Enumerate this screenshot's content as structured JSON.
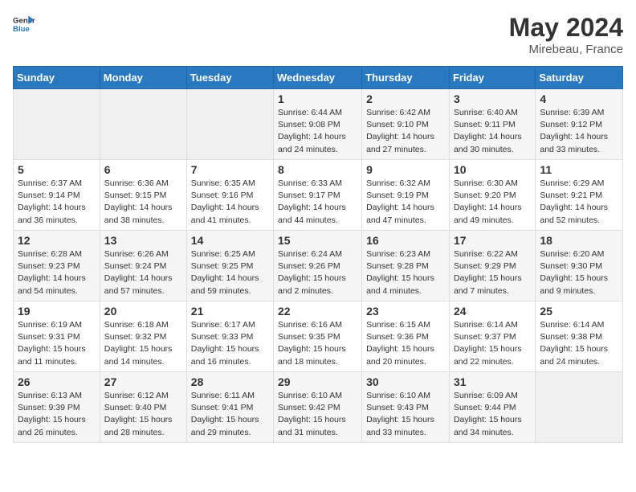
{
  "header": {
    "logo_line1": "General",
    "logo_line2": "Blue",
    "month": "May 2024",
    "location": "Mirebeau, France"
  },
  "weekdays": [
    "Sunday",
    "Monday",
    "Tuesday",
    "Wednesday",
    "Thursday",
    "Friday",
    "Saturday"
  ],
  "weeks": [
    [
      {
        "day": "",
        "info": ""
      },
      {
        "day": "",
        "info": ""
      },
      {
        "day": "",
        "info": ""
      },
      {
        "day": "1",
        "info": "Sunrise: 6:44 AM\nSunset: 9:08 PM\nDaylight: 14 hours\nand 24 minutes."
      },
      {
        "day": "2",
        "info": "Sunrise: 6:42 AM\nSunset: 9:10 PM\nDaylight: 14 hours\nand 27 minutes."
      },
      {
        "day": "3",
        "info": "Sunrise: 6:40 AM\nSunset: 9:11 PM\nDaylight: 14 hours\nand 30 minutes."
      },
      {
        "day": "4",
        "info": "Sunrise: 6:39 AM\nSunset: 9:12 PM\nDaylight: 14 hours\nand 33 minutes."
      }
    ],
    [
      {
        "day": "5",
        "info": "Sunrise: 6:37 AM\nSunset: 9:14 PM\nDaylight: 14 hours\nand 36 minutes."
      },
      {
        "day": "6",
        "info": "Sunrise: 6:36 AM\nSunset: 9:15 PM\nDaylight: 14 hours\nand 38 minutes."
      },
      {
        "day": "7",
        "info": "Sunrise: 6:35 AM\nSunset: 9:16 PM\nDaylight: 14 hours\nand 41 minutes."
      },
      {
        "day": "8",
        "info": "Sunrise: 6:33 AM\nSunset: 9:17 PM\nDaylight: 14 hours\nand 44 minutes."
      },
      {
        "day": "9",
        "info": "Sunrise: 6:32 AM\nSunset: 9:19 PM\nDaylight: 14 hours\nand 47 minutes."
      },
      {
        "day": "10",
        "info": "Sunrise: 6:30 AM\nSunset: 9:20 PM\nDaylight: 14 hours\nand 49 minutes."
      },
      {
        "day": "11",
        "info": "Sunrise: 6:29 AM\nSunset: 9:21 PM\nDaylight: 14 hours\nand 52 minutes."
      }
    ],
    [
      {
        "day": "12",
        "info": "Sunrise: 6:28 AM\nSunset: 9:23 PM\nDaylight: 14 hours\nand 54 minutes."
      },
      {
        "day": "13",
        "info": "Sunrise: 6:26 AM\nSunset: 9:24 PM\nDaylight: 14 hours\nand 57 minutes."
      },
      {
        "day": "14",
        "info": "Sunrise: 6:25 AM\nSunset: 9:25 PM\nDaylight: 14 hours\nand 59 minutes."
      },
      {
        "day": "15",
        "info": "Sunrise: 6:24 AM\nSunset: 9:26 PM\nDaylight: 15 hours\nand 2 minutes."
      },
      {
        "day": "16",
        "info": "Sunrise: 6:23 AM\nSunset: 9:28 PM\nDaylight: 15 hours\nand 4 minutes."
      },
      {
        "day": "17",
        "info": "Sunrise: 6:22 AM\nSunset: 9:29 PM\nDaylight: 15 hours\nand 7 minutes."
      },
      {
        "day": "18",
        "info": "Sunrise: 6:20 AM\nSunset: 9:30 PM\nDaylight: 15 hours\nand 9 minutes."
      }
    ],
    [
      {
        "day": "19",
        "info": "Sunrise: 6:19 AM\nSunset: 9:31 PM\nDaylight: 15 hours\nand 11 minutes."
      },
      {
        "day": "20",
        "info": "Sunrise: 6:18 AM\nSunset: 9:32 PM\nDaylight: 15 hours\nand 14 minutes."
      },
      {
        "day": "21",
        "info": "Sunrise: 6:17 AM\nSunset: 9:33 PM\nDaylight: 15 hours\nand 16 minutes."
      },
      {
        "day": "22",
        "info": "Sunrise: 6:16 AM\nSunset: 9:35 PM\nDaylight: 15 hours\nand 18 minutes."
      },
      {
        "day": "23",
        "info": "Sunrise: 6:15 AM\nSunset: 9:36 PM\nDaylight: 15 hours\nand 20 minutes."
      },
      {
        "day": "24",
        "info": "Sunrise: 6:14 AM\nSunset: 9:37 PM\nDaylight: 15 hours\nand 22 minutes."
      },
      {
        "day": "25",
        "info": "Sunrise: 6:14 AM\nSunset: 9:38 PM\nDaylight: 15 hours\nand 24 minutes."
      }
    ],
    [
      {
        "day": "26",
        "info": "Sunrise: 6:13 AM\nSunset: 9:39 PM\nDaylight: 15 hours\nand 26 minutes."
      },
      {
        "day": "27",
        "info": "Sunrise: 6:12 AM\nSunset: 9:40 PM\nDaylight: 15 hours\nand 28 minutes."
      },
      {
        "day": "28",
        "info": "Sunrise: 6:11 AM\nSunset: 9:41 PM\nDaylight: 15 hours\nand 29 minutes."
      },
      {
        "day": "29",
        "info": "Sunrise: 6:10 AM\nSunset: 9:42 PM\nDaylight: 15 hours\nand 31 minutes."
      },
      {
        "day": "30",
        "info": "Sunrise: 6:10 AM\nSunset: 9:43 PM\nDaylight: 15 hours\nand 33 minutes."
      },
      {
        "day": "31",
        "info": "Sunrise: 6:09 AM\nSunset: 9:44 PM\nDaylight: 15 hours\nand 34 minutes."
      },
      {
        "day": "",
        "info": ""
      }
    ]
  ]
}
